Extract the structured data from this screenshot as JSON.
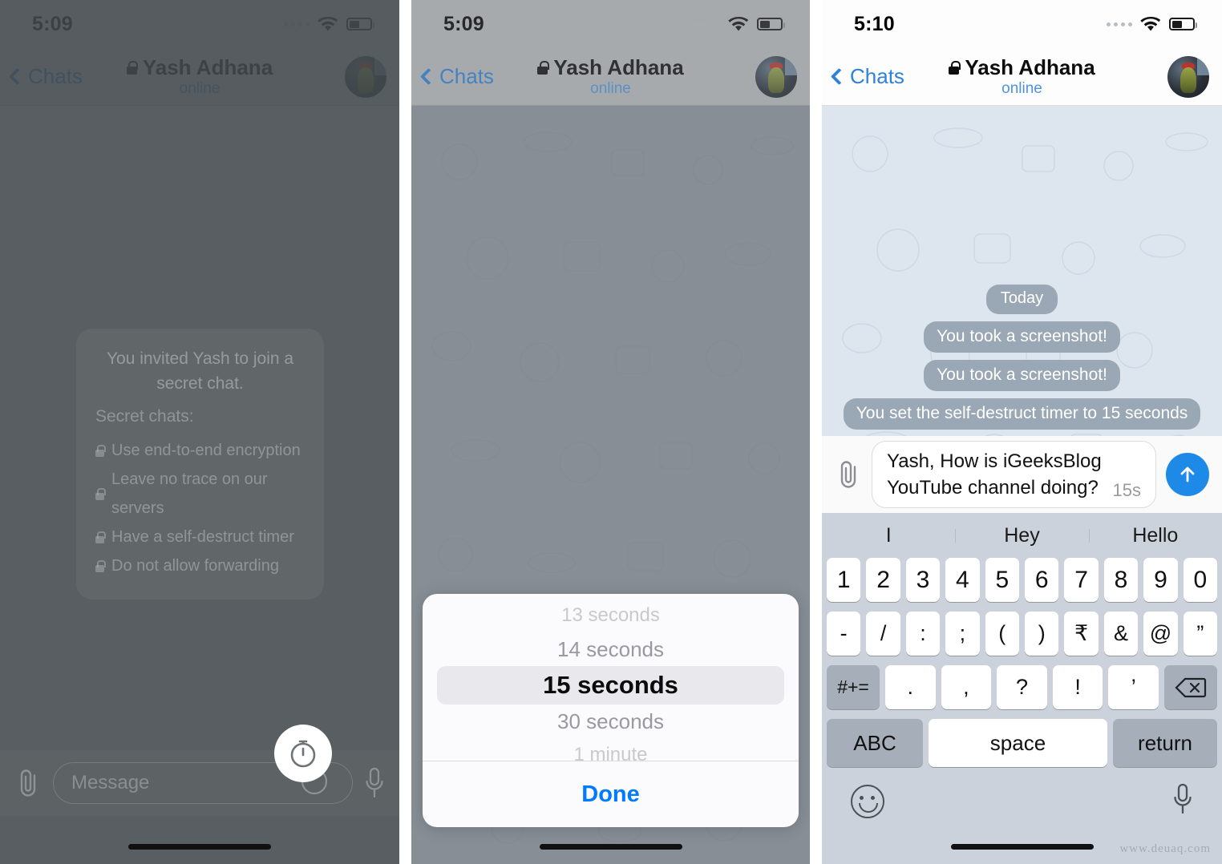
{
  "panels": [
    {
      "status": {
        "time": "5:09"
      },
      "nav": {
        "back": "Chats",
        "title": "Yash Adhana",
        "subtitle": "online"
      },
      "secret_card": {
        "heading": "You invited Yash to join a secret chat.",
        "subheading": "Secret chats:",
        "items": [
          "Use end-to-end encryption",
          "Leave no trace on our servers",
          "Have a self-destruct timer",
          "Do not allow forwarding"
        ]
      },
      "composer": {
        "placeholder": "Message",
        "attach_icon": "paperclip-icon",
        "timer_icon": "self-destruct-timer-icon",
        "sticker_icon": "sticker-icon",
        "mic_icon": "microphone-icon"
      }
    },
    {
      "status": {
        "time": "5:09"
      },
      "nav": {
        "back": "Chats",
        "title": "Yash Adhana",
        "subtitle": "online"
      },
      "picker": {
        "options": [
          "13 seconds",
          "14 seconds",
          "15 seconds",
          "30 seconds",
          "1 minute"
        ],
        "selected": "15 seconds",
        "done_label": "Done",
        "accent": "#007aff"
      }
    },
    {
      "status": {
        "time": "5:10"
      },
      "nav": {
        "back": "Chats",
        "title": "Yash Adhana",
        "subtitle": "online"
      },
      "messages": [
        {
          "text": "Today",
          "kind": "date"
        },
        {
          "text": "You took a screenshot!",
          "kind": "service"
        },
        {
          "text": "You took a screenshot!",
          "kind": "service"
        },
        {
          "text": "You set the self-destruct timer to 15 seconds",
          "kind": "service"
        }
      ],
      "composer": {
        "attach_icon": "paperclip-icon",
        "value_line1": "Yash, How is iGeeksBlog",
        "value_line2": "YouTube channel doing?",
        "timer_badge": "15s",
        "send_icon": "send-arrow-up-icon",
        "send_color": "#1e8ae8"
      },
      "keyboard": {
        "suggestions": [
          "I",
          "Hey",
          "Hello"
        ],
        "row1": [
          "1",
          "2",
          "3",
          "4",
          "5",
          "6",
          "7",
          "8",
          "9",
          "0"
        ],
        "row2": [
          "-",
          "/",
          ":",
          ";",
          "(",
          ")",
          "₹",
          "&",
          "@",
          "”"
        ],
        "row3_fn": "#+=",
        "row3": [
          ".",
          ",",
          "?",
          "!",
          "’"
        ],
        "row3_backspace_icon": "backspace-icon",
        "abc_label": "ABC",
        "space_label": "space",
        "return_label": "return",
        "emoji_icon": "emoji-smiley-icon",
        "dictation_icon": "microphone-icon"
      }
    }
  ],
  "watermark": "www.deuaq.com"
}
